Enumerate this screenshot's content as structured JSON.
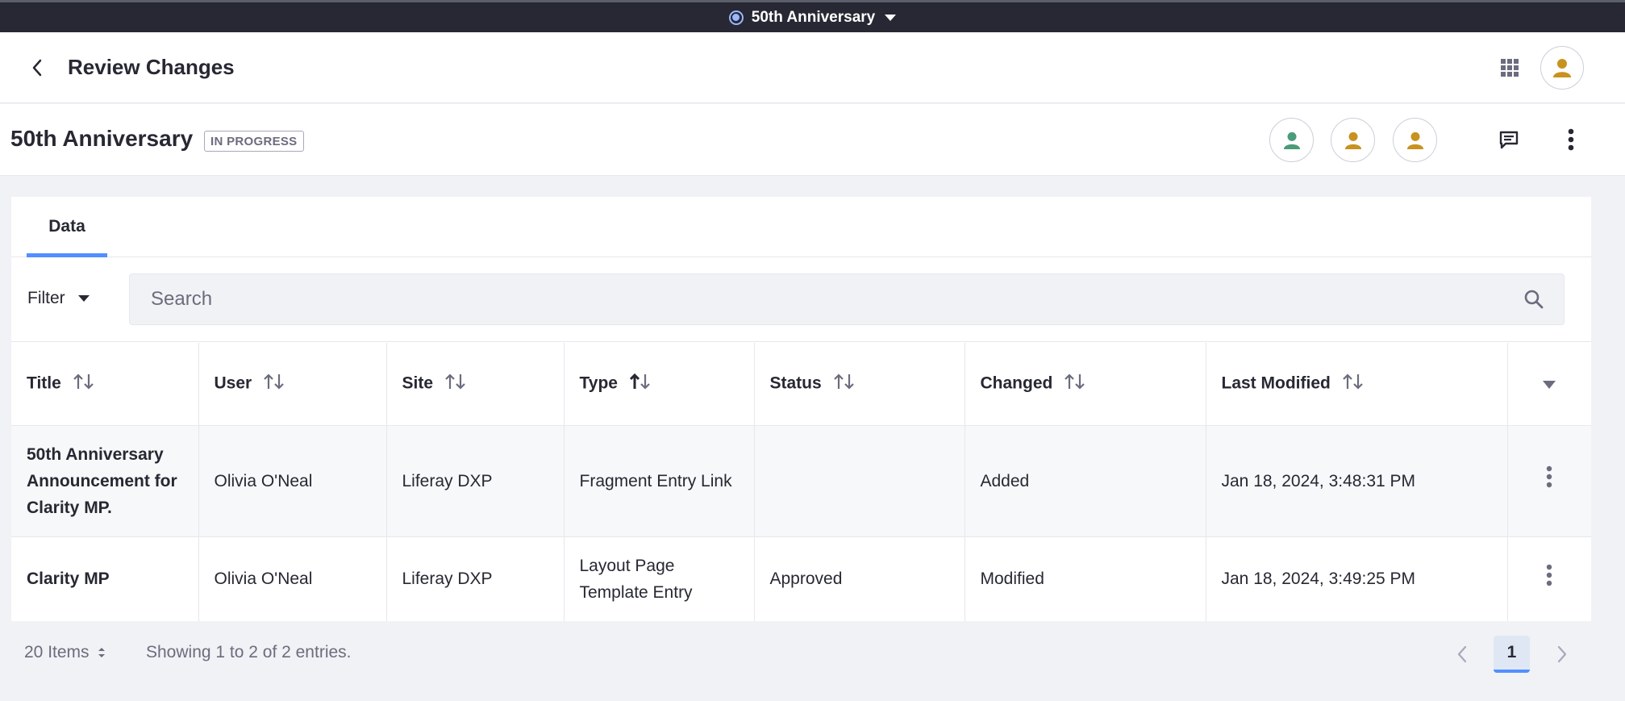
{
  "publication_bar": {
    "name": "50th Anniversary",
    "icon": "radio-dot-icon"
  },
  "header": {
    "title": "Review Changes"
  },
  "ct": {
    "title": "50th Anniversary",
    "status_badge": "IN PROGRESS",
    "colors": {
      "user_green": "#4b9c7a",
      "user_gold": "#c8921f"
    }
  },
  "tabs": [
    {
      "label": "Data"
    }
  ],
  "toolbar": {
    "filter_label": "Filter",
    "search_placeholder": "Search"
  },
  "table": {
    "columns": [
      "Title",
      "User",
      "Site",
      "Type",
      "Status",
      "Changed",
      "Last Modified"
    ],
    "rows": [
      {
        "title": "50th Anniversary Announcement for Clarity MP.",
        "user": "Olivia O'Neal",
        "site": "Liferay DXP",
        "type": "Fragment Entry Link",
        "status": "",
        "changed": "Added",
        "last_modified": "Jan 18, 2024, 3:48:31 PM"
      },
      {
        "title": "Clarity MP",
        "user": "Olivia O'Neal",
        "site": "Liferay DXP",
        "type": "Layout Page Template Entry",
        "status": "Approved",
        "changed": "Modified",
        "last_modified": "Jan 18, 2024, 3:49:25 PM"
      }
    ]
  },
  "pagination": {
    "per_page": "20 Items",
    "info": "Showing 1 to 2 of 2 entries.",
    "current_page": "1"
  },
  "accent_color": "#528eff"
}
